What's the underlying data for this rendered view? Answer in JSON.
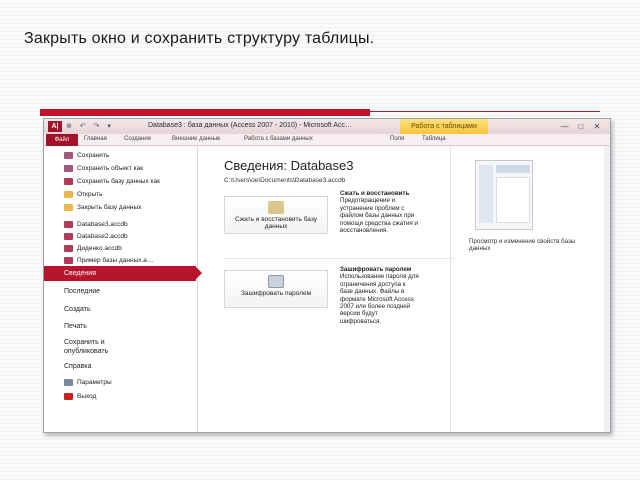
{
  "slide": {
    "title": "Закрыть окно и сохранить структуру таблицы."
  },
  "window": {
    "app_icon_label": "A|",
    "qat_icons": "⊕ ↶ ↷ ▾",
    "title": "Database3 : база данных (Access 2007 - 2010) - Microsoft Acc…",
    "context_tab": "Работа с таблицами",
    "buttons": {
      "minimize": "—",
      "restore": "□",
      "close": "✕"
    }
  },
  "ribbon": {
    "tabs": [
      "Файл",
      "Главная",
      "Создание",
      "Внешние данные",
      "Работа с базами данных",
      "Поля",
      "Таблица"
    ]
  },
  "backstage": {
    "nav_items": [
      {
        "label": "Сохранить",
        "icon": "save-icon"
      },
      {
        "label": "Сохранить объект как",
        "icon": "save-as-icon"
      },
      {
        "label": "Сохранить базу данных как",
        "icon": "save-db-icon"
      },
      {
        "label": "Открыть",
        "icon": "folder-icon"
      },
      {
        "label": "Закрыть базу данных",
        "icon": "close-db-icon"
      }
    ],
    "recent_files": [
      {
        "label": "Database3.accdb"
      },
      {
        "label": "Database2.accdb"
      },
      {
        "label": "Диденко.accdb"
      },
      {
        "label": "Пример базы данных.a…"
      }
    ],
    "selected_section": "Сведения",
    "sections": [
      "Последние",
      "Создать",
      "Печать",
      "Сохранить и опубликовать",
      "Справка"
    ],
    "footer_items": [
      {
        "label": "Параметры",
        "icon": "options-icon"
      },
      {
        "label": "Выход",
        "icon": "exit-icon"
      }
    ]
  },
  "info": {
    "title": "Сведения: Database3",
    "path": "C:\\Users\\oe\\Documents\\Database3.accdb",
    "compact": {
      "button_label": "Сжать и восстановить базу данных",
      "heading": "Сжать и восстановить",
      "description": "Предотвращение и устранение проблем с файлом базы данных при помощи средства сжатия и восстановления."
    },
    "encrypt": {
      "button_label": "Зашифровать паролем",
      "heading": "Зашифровать паролем",
      "description": "Использование пароля для ограничения доступа к базе данных. Файлы в формате Microsoft Access 2007 или более поздней версии будут шифроваться."
    }
  },
  "preview": {
    "caption": "Просмотр и изменение свойств базы данных"
  },
  "colors": {
    "accent": "#b8142e",
    "context_tab": "#f5c23b"
  }
}
